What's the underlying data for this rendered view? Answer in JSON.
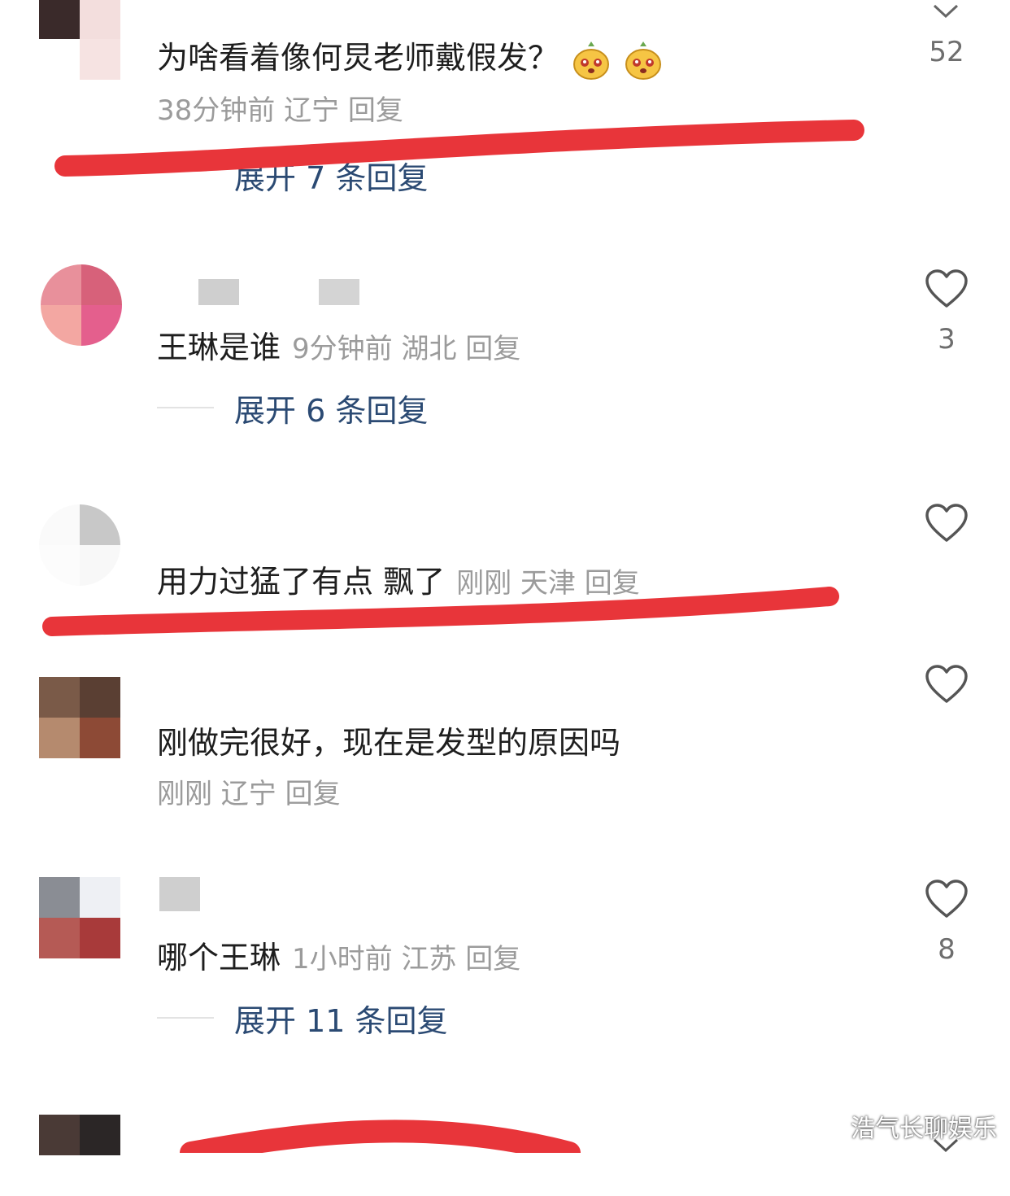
{
  "comments": [
    {
      "text": "为啥看着像何炅老师戴假发？",
      "meta": "38分钟前 辽宁 回复",
      "likes": "52",
      "expand": "展开 7 条回复"
    },
    {
      "text": "王琳是谁",
      "meta": "9分钟前 湖北 回复",
      "likes": "3",
      "expand": "展开 6 条回复"
    },
    {
      "text": "用力过猛了有点 飘了",
      "meta": "刚刚 天津 回复",
      "likes": ""
    },
    {
      "text": "刚做完很好，现在是发型的原因吗",
      "meta": "刚刚 辽宁 回复",
      "likes": ""
    },
    {
      "text": "哪个王琳",
      "meta": "1小时前 江苏 回复",
      "likes": "8",
      "expand": "展开 11 条回复"
    }
  ],
  "watermark": "浩气长聊娱乐",
  "colors": {
    "annotation_red": "#e8353a",
    "link_blue": "#2b4a73",
    "meta_gray": "#9b9b9b"
  },
  "icons": [
    "heart-icon",
    "chevron-down-icon",
    "emoji-face-icon"
  ]
}
